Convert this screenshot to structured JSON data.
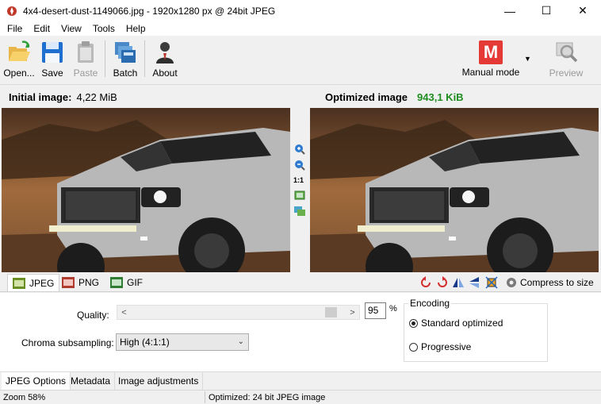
{
  "window": {
    "title": "4x4-desert-dust-1149066.jpg - 1920x1280 px @ 24bit JPEG",
    "minimize": "—",
    "maximize": "☐",
    "close": "✕"
  },
  "menu": [
    "File",
    "Edit",
    "View",
    "Tools",
    "Help"
  ],
  "toolbar": {
    "open": "Open...",
    "save": "Save",
    "paste": "Paste",
    "batch": "Batch",
    "about": "About",
    "manual_mode": "Manual mode",
    "manual_mode_badge": "M",
    "preview": "Preview"
  },
  "images": {
    "initial_label": "Initial image:",
    "initial_size": "4,22 MiB",
    "optimized_label": "Optimized image",
    "optimized_size": "943,1 KiB"
  },
  "zoom": {
    "one_to_one": "1:1"
  },
  "format_tabs": {
    "jpeg": "JPEG",
    "png": "PNG",
    "gif": "GIF",
    "compress_to_size": "Compress to size"
  },
  "jpeg_options": {
    "quality_label": "Quality:",
    "quality_value": "95",
    "quality_unit": "%",
    "chroma_label": "Chroma subsampling:",
    "chroma_value": "High (4:1:1)",
    "encoding_legend": "Encoding",
    "standard_optimized": "Standard optimized",
    "progressive": "Progressive"
  },
  "bottom_tabs": [
    "JPEG Options",
    "Metadata",
    "Image adjustments"
  ],
  "status": {
    "zoom": "Zoom 58%",
    "info": "Optimized: 24 bit JPEG image"
  },
  "colors": {
    "optimized_size": "#1e8c1e",
    "manual_badge": "#e53935"
  }
}
